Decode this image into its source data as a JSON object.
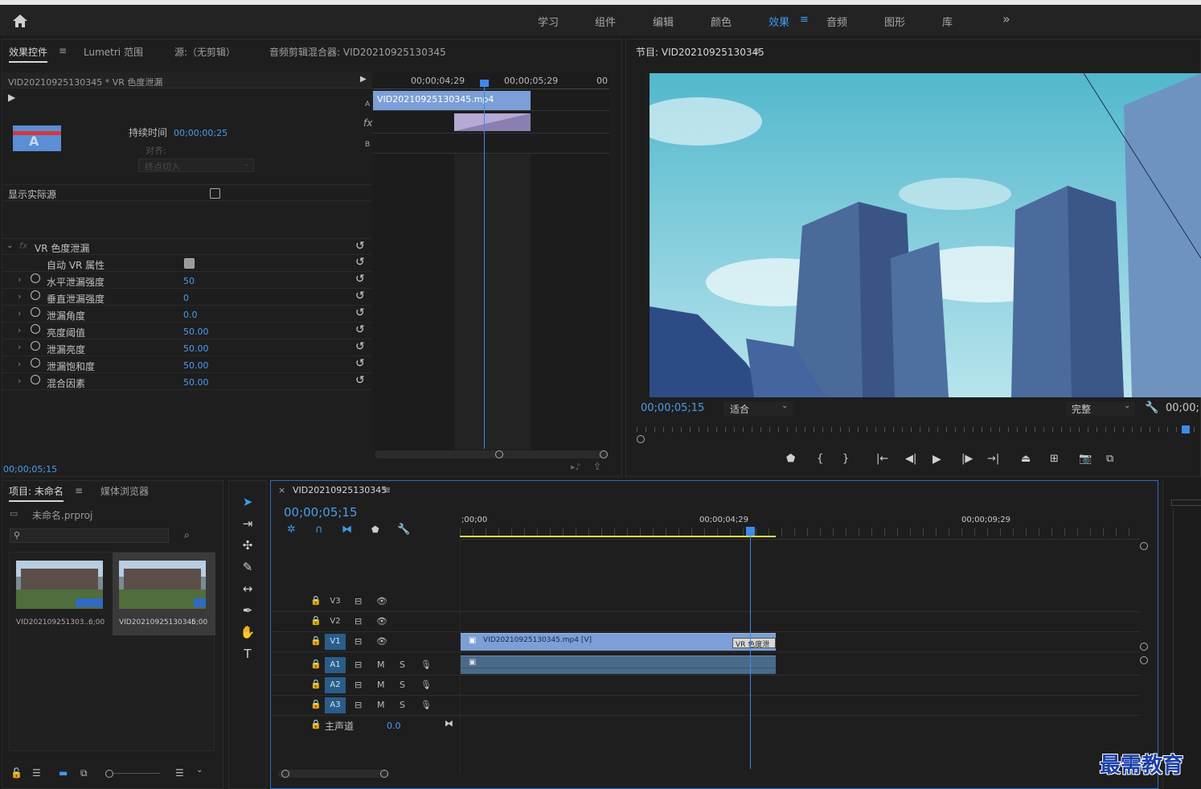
{
  "workspace": {
    "tabs": [
      "学习",
      "组件",
      "编辑",
      "颜色",
      "效果",
      "音频",
      "图形",
      "库"
    ],
    "active": "效果",
    "more": "»"
  },
  "effect_panel": {
    "tabs": [
      "效果控件",
      "Lumetri 范围",
      "源:（无剪辑）",
      "音频剪辑混合器: VID20210925130345"
    ],
    "clip_header": "VID20210925130345 * VR 色度泄漏",
    "duration_label": "持续时间",
    "duration_value": "00;00;00;25",
    "align_label": "对齐:",
    "align_value": "终点切入",
    "show_source_label": "显示实际源",
    "effect_name": "VR 色度泄漏",
    "auto_vr_label": "自动 VR 属性",
    "params": [
      {
        "label": "水平泄漏强度",
        "value": "50"
      },
      {
        "label": "垂直泄漏强度",
        "value": "0"
      },
      {
        "label": "泄漏角度",
        "value": "0.0"
      },
      {
        "label": "亮度阈值",
        "value": "50.00"
      },
      {
        "label": "泄漏亮度",
        "value": "50.00"
      },
      {
        "label": "泄漏饱和度",
        "value": "50.00"
      },
      {
        "label": "混合因素",
        "value": "50.00"
      }
    ],
    "timecode": "00;00;05;15",
    "mini_timeline": {
      "ruler": [
        "00;00;04;29",
        "00;00;05;29",
        "00"
      ],
      "clip_name": "VID20210925130345.mp4",
      "track_a": "A",
      "track_b": "B",
      "fx": "fx"
    }
  },
  "program": {
    "title": "节目: VID20210925130345",
    "timecode": "00;00;05;15",
    "fit": "适合",
    "quality": "完整",
    "end_timecode": "00;00;"
  },
  "project": {
    "tabs": [
      "项目: 未命名",
      "媒体浏览器"
    ],
    "file": "未命名.prproj",
    "items": [
      {
        "name": "VID202109251303...",
        "duration": "6;00"
      },
      {
        "name": "VID20210925130345",
        "duration": "6;00"
      }
    ]
  },
  "timeline": {
    "seq_name": "VID20210925130345",
    "timecode": "00;00;05;15",
    "ruler": [
      ";00;00",
      "00;00;04;29",
      "00;00;09;29"
    ],
    "tracks": [
      {
        "id": "V3",
        "on": false,
        "type": "video"
      },
      {
        "id": "V2",
        "on": false,
        "type": "video"
      },
      {
        "id": "V1",
        "on": true,
        "type": "video"
      },
      {
        "id": "A1",
        "on": true,
        "type": "audio"
      },
      {
        "id": "A2",
        "on": true,
        "type": "audio"
      },
      {
        "id": "A3",
        "on": true,
        "type": "audio"
      }
    ],
    "master_label": "主声道",
    "master_value": "0.0",
    "video_clip": "VID20210925130345.mp4 [V]",
    "fx_badge": "VR 色度泄",
    "mute": "M",
    "solo": "S"
  },
  "watermark": "最需教育",
  "colors": {
    "accent": "#3d9bf2",
    "clip_video": "#7b9fd6",
    "clip_audio": "#4a6a8a",
    "playhead": "#3d8ae8"
  }
}
